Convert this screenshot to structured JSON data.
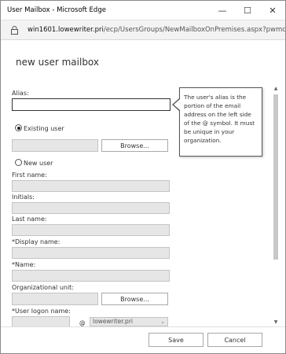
{
  "window": {
    "title": "User Mailbox - Microsoft Edge",
    "controls": {
      "minimize": "—",
      "maximize": "☐",
      "close": "✕"
    }
  },
  "address": {
    "host": "win1601.lowewriter.pri",
    "path": "/ecp/UsersGroups/NewMailboxOnPremises.aspx?pwmc"
  },
  "form": {
    "title": "new user mailbox",
    "alias_label": "Alias:",
    "alias_value": "",
    "tooltip": "The user's alias is the portion of the email address on the left side of the @ symbol. It must be unique in your organization.",
    "existing_user_label": "Existing user",
    "browse_label": "Browse...",
    "new_user_label": "New user",
    "first_name_label": "First name:",
    "initials_label": "Initials:",
    "last_name_label": "Last name:",
    "display_name_label": "*Display name:",
    "name_label": "*Name:",
    "ou_label": "Organizational unit:",
    "ou_browse_label": "Browse...",
    "logon_name_label": "*User logon name:",
    "at_symbol": "@",
    "domain_value": "lowewriter.pri"
  },
  "footer": {
    "save_label": "Save",
    "cancel_label": "Cancel"
  }
}
